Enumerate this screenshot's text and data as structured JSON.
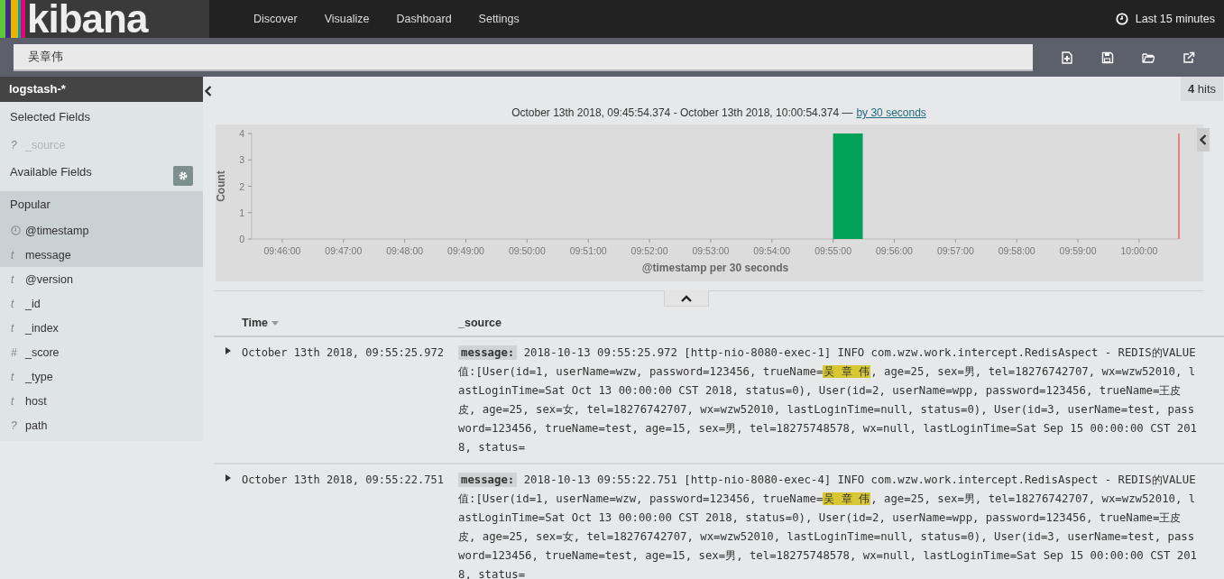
{
  "logo": {
    "text": "kibana"
  },
  "nav": [
    {
      "label": "Discover",
      "selected": false
    },
    {
      "label": "Visualize",
      "selected": false
    },
    {
      "label": "Dashboard",
      "selected": false
    },
    {
      "label": "Settings",
      "selected": false
    }
  ],
  "timepicker": {
    "label": "Last 15 minutes"
  },
  "search": {
    "value": "吴章伟"
  },
  "sidebar": {
    "index_pattern": "logstash-*",
    "selected_fields": {
      "title": "Selected Fields",
      "items": [
        {
          "kind": "text",
          "glyph": "?",
          "name": "_source",
          "disabled": true
        }
      ]
    },
    "available_fields": {
      "title": "Available Fields"
    },
    "popular": {
      "title": "Popular",
      "items": [
        {
          "kind": "date",
          "name": "@timestamp"
        },
        {
          "kind": "text",
          "glyph": "t",
          "name": "message"
        }
      ]
    },
    "fields": [
      {
        "kind": "text",
        "glyph": "t",
        "name": "@version"
      },
      {
        "kind": "text",
        "glyph": "t",
        "name": "_id"
      },
      {
        "kind": "text",
        "glyph": "t",
        "name": "_index"
      },
      {
        "kind": "text",
        "glyph": "#",
        "name": "_score"
      },
      {
        "kind": "text",
        "glyph": "t",
        "name": "_type"
      },
      {
        "kind": "text",
        "glyph": "t",
        "name": "host"
      },
      {
        "kind": "text",
        "glyph": "?",
        "name": "path"
      }
    ]
  },
  "hits": "**4** hits",
  "time_range": {
    "text": "October 13th 2018, 09:45:54.374 - October 13th 2018, 10:00:54.374 —",
    "interval_link": "by 30 seconds"
  },
  "chart_data": {
    "type": "bar",
    "xlabel": "@timestamp per 30 seconds",
    "ylabel": "Count",
    "categories": [
      "09:46:00",
      "09:47:00",
      "09:48:00",
      "09:49:00",
      "09:50:00",
      "09:51:00",
      "09:52:00",
      "09:53:00",
      "09:54:00",
      "09:55:00",
      "09:56:00",
      "09:57:00",
      "09:58:00",
      "09:59:00",
      "10:00:00"
    ],
    "series": [
      {
        "color": "#00a25a",
        "values": [
          0,
          0,
          0,
          0,
          0,
          0,
          0,
          0,
          0,
          4,
          0,
          0,
          0,
          0,
          0
        ]
      }
    ],
    "ylim": [
      0,
      4
    ],
    "yticks": [
      0,
      1,
      2,
      3,
      4
    ]
  },
  "table": {
    "columns": [
      {
        "label": "Time",
        "sorted": true
      },
      {
        "label": "_source",
        "sorted": false
      }
    ],
    "rows": [
      {
        "expanded": false,
        "time": "October 13th 2018, 09:55:25.972",
        "field_label": "message:",
        "text_before": "2018-10-13 09:55:25.972 [http-nio-8080-exec-1] INFO com.wzw.work.intercept.RedisAspect - REDIS的VALUE值:[User(id=1, userName=wzw, password=123456, trueName=",
        "highlight": "吴 章 伟",
        "text_after": ", age=25, sex=男, tel=18276742707, wx=wzw52010, lastLoginTime=Sat Oct 13 00:00:00 CST 2018, status=0), User(id=2, userName=wpp, password=123456, trueName=王皮皮, age=25, sex=女, tel=18276742707, wx=wzw52010, lastLoginTime=null, status=0), User(id=3, userName=test, password=123456, trueName=test, age=15, sex=男, tel=18275748578, wx=null, lastLoginTime=Sat Sep 15 00:00:00 CST 2018, status="
      },
      {
        "expanded": false,
        "time": "October 13th 2018, 09:55:22.751",
        "field_label": "message:",
        "text_before": "2018-10-13 09:55:22.751 [http-nio-8080-exec-4] INFO com.wzw.work.intercept.RedisAspect - REDIS的VALUE值:[User(id=1, userName=wzw, password=123456, trueName=",
        "highlight": "吴 章 伟",
        "text_after": ", age=25, sex=男, tel=18276742707, wx=wzw52010, lastLoginTime=Sat Oct 13 00:00:00 CST 2018, status=0), User(id=2, userName=wpp, password=123456, trueName=王皮皮, age=25, sex=女, tel=18276742707, wx=wzw52010, lastLoginTime=null, status=0), User(id=3, userName=test, password=123456, trueName=test, age=15, sex=男, tel=18275748578, wx=null, lastLoginTime=Sat Sep 15 00:00:00 CST 2018, status="
      }
    ]
  }
}
